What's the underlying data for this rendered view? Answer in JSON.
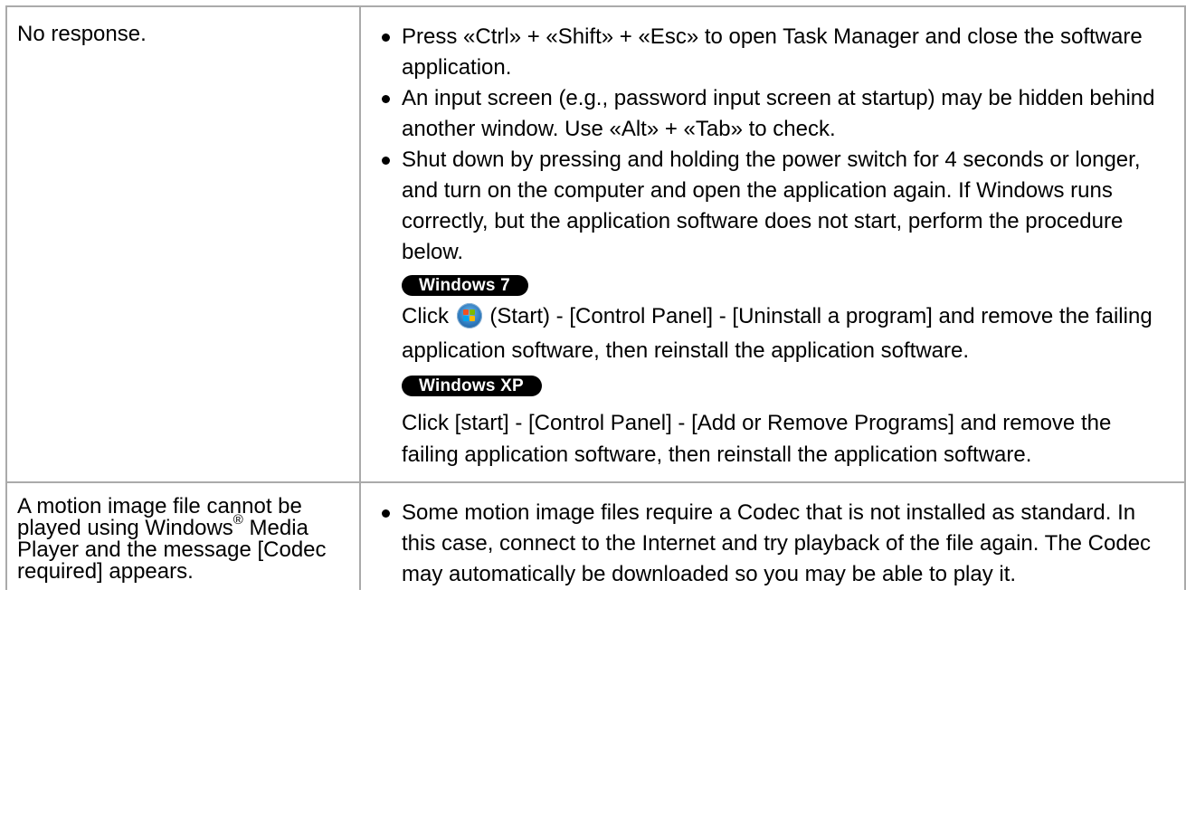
{
  "rows": [
    {
      "symptom": "No response.",
      "solutions": [
        "Press «Ctrl» + «Shift» + «Esc» to open Task Manager and close the software application.",
        "An input screen (e.g., password input screen at startup) may be hidden behind another window. Use «Alt» + «Tab» to check.",
        "Shut down by pressing and holding the power switch for 4 seconds or longer, and turn on the computer and open the application again. If Windows runs correctly, but the application software does not start, perform the procedure below."
      ],
      "os_sections": {
        "win7": {
          "badge": "Windows 7",
          "click_prefix": "Click",
          "click_suffix": "(Start) - [Control Panel] - [Uninstall a program] and",
          "rest": "remove the failing application software, then reinstall the application software."
        },
        "winxp": {
          "badge": "Windows XP",
          "text": "Click [start] - [Control Panel] - [Add or Remove Programs] and remove the failing application software, then reinstall the application software."
        }
      }
    },
    {
      "symptom_parts": {
        "before": "A motion image file cannot be played using Windows",
        "reg": "®",
        "after": " Media Player and the message [Codec required] appears."
      },
      "solutions": [
        "Some motion image files require a Codec that is not installed as standard. In this case, connect to the Internet and try playback of the file again. The Codec may automatically be downloaded so you may be able to play it."
      ]
    }
  ],
  "icons": {
    "start": "windows-start-orb-icon"
  },
  "colors": {
    "border": "#aaaaaa",
    "badge_bg": "#000000",
    "badge_text": "#ffffff"
  }
}
